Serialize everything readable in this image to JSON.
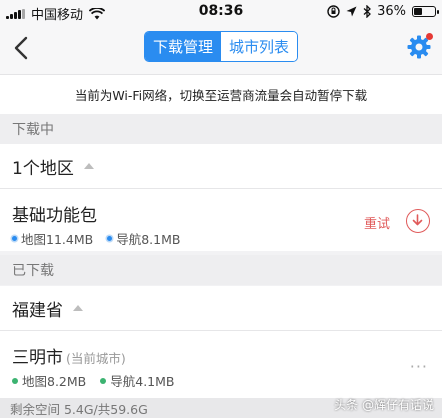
{
  "status_bar": {
    "carrier": "中国移动",
    "time": "08:36",
    "battery_text": "36%",
    "battery_level": 0.36,
    "icons": [
      "signal-icon",
      "wifi-icon",
      "orientation-lock-icon",
      "location-icon",
      "bluetooth-icon",
      "battery-icon"
    ]
  },
  "nav": {
    "tabs": [
      {
        "label": "下载管理",
        "active": true
      },
      {
        "label": "城市列表",
        "active": false
      }
    ],
    "icons": [
      "back-chevron-icon",
      "gear-icon"
    ],
    "accent_color": "#2a8cf0"
  },
  "notice": "当前为Wi-Fi网络，切换至运营商流量会自动暂停下载",
  "downloading": {
    "header": "下载中",
    "group_label": "1个地区",
    "item": {
      "title": "基础功能包",
      "map_size": "地图11.4MB",
      "nav_size": "导航8.1MB",
      "retry_label": "重试"
    }
  },
  "downloaded": {
    "header": "已下载",
    "group_label": "福建省",
    "item": {
      "title": "三明市",
      "subtitle": "(当前城市)",
      "map_size": "地图8.2MB",
      "nav_size": "导航4.1MB",
      "more": "···"
    }
  },
  "storage_text": "剩余空间 5.4G/共59.6G",
  "watermark": "头条 @辉仔有话说"
}
